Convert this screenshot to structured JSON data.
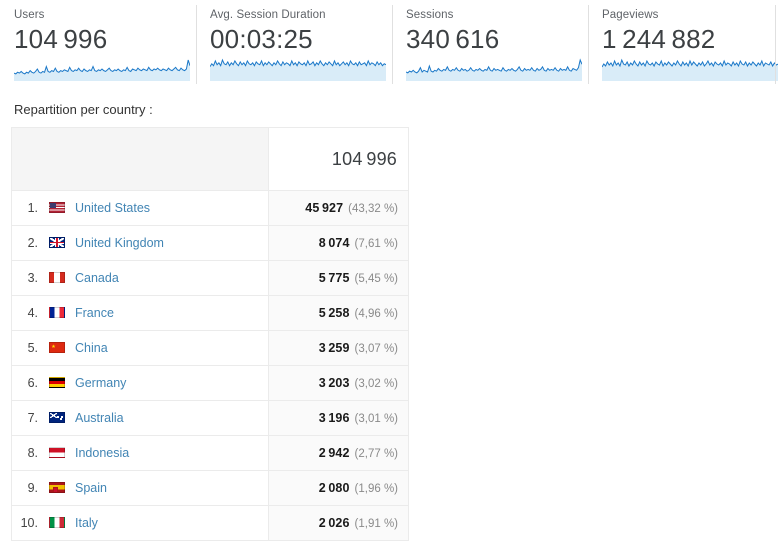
{
  "metrics": [
    {
      "label": "Users",
      "value": "104 996",
      "sparkline": "users-sparkline"
    },
    {
      "label": "Avg. Session Duration",
      "value": "00:03:25",
      "sparkline": "session-duration-sparkline"
    },
    {
      "label": "Sessions",
      "value": "340 616",
      "sparkline": "sessions-sparkline"
    },
    {
      "label": "Pageviews",
      "value": "1 244 882",
      "sparkline": "pageviews-sparkline"
    }
  ],
  "section": {
    "title": "Repartition per country :"
  },
  "table": {
    "header": {
      "left_label": "",
      "total": "104 996"
    },
    "rows": [
      {
        "rank": "1.",
        "country": "United States",
        "flag": "flag-us",
        "value": "45 927",
        "percent": "(43,32 %)"
      },
      {
        "rank": "2.",
        "country": "United Kingdom",
        "flag": "flag-gb",
        "value": "8 074",
        "percent": "(7,61 %)"
      },
      {
        "rank": "3.",
        "country": "Canada",
        "flag": "flag-ca",
        "value": "5 775",
        "percent": "(5,45 %)"
      },
      {
        "rank": "4.",
        "country": "France",
        "flag": "flag-fr",
        "value": "5 258",
        "percent": "(4,96 %)"
      },
      {
        "rank": "5.",
        "country": "China",
        "flag": "flag-cn",
        "value": "3 259",
        "percent": "(3,07 %)"
      },
      {
        "rank": "6.",
        "country": "Germany",
        "flag": "flag-de",
        "value": "3 203",
        "percent": "(3,02 %)"
      },
      {
        "rank": "7.",
        "country": "Australia",
        "flag": "flag-au",
        "value": "3 196",
        "percent": "(3,01 %)"
      },
      {
        "rank": "8.",
        "country": "Indonesia",
        "flag": "flag-id",
        "value": "2 942",
        "percent": "(2,77 %)"
      },
      {
        "rank": "9.",
        "country": "Spain",
        "flag": "flag-es",
        "value": "2 080",
        "percent": "(1,96 %)"
      },
      {
        "rank": "10.",
        "country": "Italy",
        "flag": "flag-it",
        "value": "2 026",
        "percent": "(1,91 %)"
      }
    ]
  },
  "colors": {
    "sparkline_line": "#1b78c8",
    "sparkline_fill": "#d9ecf8",
    "link": "#4285b4",
    "value_text": "#1a1a1a",
    "percent_text": "#8a8a8a",
    "header_left_bg": "#f5f5f5",
    "row_value_bg": "#fafafa",
    "border": "#ebebeb"
  },
  "chart_data": [
    {
      "type": "area",
      "title": "Users",
      "ylabel": "",
      "xlabel": "",
      "total": 104996,
      "series": [
        {
          "name": "Users",
          "values": [
            6,
            5,
            7,
            6,
            8,
            6,
            5,
            7,
            6,
            9,
            7,
            6,
            8,
            11,
            7,
            6,
            8,
            7,
            14,
            8,
            7,
            9,
            8,
            12,
            8,
            7,
            9,
            8,
            10,
            9,
            8,
            13,
            9,
            8,
            10,
            9,
            12,
            9,
            8,
            11,
            9,
            8,
            10,
            9,
            14,
            9,
            8,
            10,
            9,
            11,
            9,
            8,
            10,
            12,
            9,
            8,
            10,
            9,
            11,
            9,
            8,
            10,
            9,
            13,
            9,
            8,
            11,
            10,
            9,
            12,
            10,
            9,
            11,
            10,
            9,
            13,
            10,
            9,
            11,
            10,
            12,
            10,
            9,
            11,
            10,
            9,
            12,
            10,
            9,
            11,
            13,
            10,
            9,
            12,
            10,
            9,
            11,
            22,
            15
          ]
        }
      ]
    },
    {
      "type": "area",
      "title": "Avg. Session Duration",
      "value_display": "00:03:25",
      "series": [
        {
          "name": "Avg. Session Duration",
          "values": [
            12,
            15,
            13,
            18,
            14,
            16,
            13,
            19,
            15,
            14,
            17,
            13,
            16,
            14,
            18,
            15,
            13,
            17,
            14,
            16,
            13,
            18,
            15,
            14,
            16,
            13,
            17,
            15,
            14,
            18,
            13,
            16,
            14,
            17,
            15,
            13,
            16,
            14,
            18,
            15,
            13,
            17,
            14,
            16,
            15,
            13,
            18,
            14,
            16,
            13,
            17,
            15,
            14,
            16,
            13,
            18,
            14,
            15,
            17,
            13,
            16,
            14,
            18,
            15,
            13,
            16,
            14,
            17,
            15,
            13,
            18,
            14,
            16,
            13,
            15,
            17,
            14,
            16,
            13,
            18,
            15,
            14,
            16,
            13,
            17,
            14,
            15,
            16,
            13,
            18,
            14,
            16,
            15,
            13,
            17,
            14,
            16,
            13,
            15,
            14
          ]
        }
      ]
    },
    {
      "type": "area",
      "title": "Sessions",
      "total": 340616,
      "series": [
        {
          "name": "Sessions",
          "values": [
            7,
            6,
            8,
            7,
            9,
            7,
            6,
            8,
            12,
            7,
            9,
            8,
            7,
            14,
            8,
            7,
            9,
            8,
            11,
            9,
            8,
            10,
            9,
            13,
            9,
            8,
            10,
            9,
            12,
            9,
            8,
            11,
            9,
            10,
            8,
            9,
            12,
            9,
            8,
            10,
            9,
            11,
            9,
            8,
            10,
            9,
            13,
            9,
            8,
            11,
            9,
            10,
            9,
            8,
            12,
            9,
            8,
            10,
            9,
            11,
            9,
            8,
            10,
            13,
            9,
            8,
            11,
            9,
            10,
            9,
            12,
            9,
            8,
            11,
            9,
            10,
            13,
            9,
            8,
            11,
            9,
            10,
            9,
            12,
            9,
            8,
            11,
            9,
            10,
            9,
            13,
            9,
            8,
            11,
            10,
            9,
            12,
            21,
            16
          ]
        }
      ]
    },
    {
      "type": "area",
      "title": "Pageviews",
      "total": 1244882,
      "series": [
        {
          "name": "Pageviews",
          "values": [
            11,
            14,
            12,
            16,
            13,
            15,
            12,
            17,
            13,
            15,
            12,
            18,
            14,
            13,
            16,
            12,
            15,
            13,
            17,
            14,
            12,
            16,
            13,
            15,
            12,
            17,
            14,
            13,
            15,
            12,
            16,
            14,
            13,
            17,
            12,
            15,
            13,
            16,
            14,
            12,
            15,
            13,
            17,
            14,
            12,
            16,
            13,
            15,
            12,
            17,
            13,
            16,
            14,
            12,
            15,
            13,
            16,
            12,
            14,
            17,
            13,
            15,
            12,
            16,
            14,
            13,
            15,
            12,
            17,
            13,
            15,
            14,
            12,
            16,
            13,
            15,
            12,
            17,
            14,
            13,
            16,
            12,
            15,
            13,
            16,
            14,
            12,
            15,
            13,
            17,
            12,
            15,
            14,
            13,
            16,
            12,
            15,
            13,
            14
          ]
        }
      ]
    }
  ]
}
